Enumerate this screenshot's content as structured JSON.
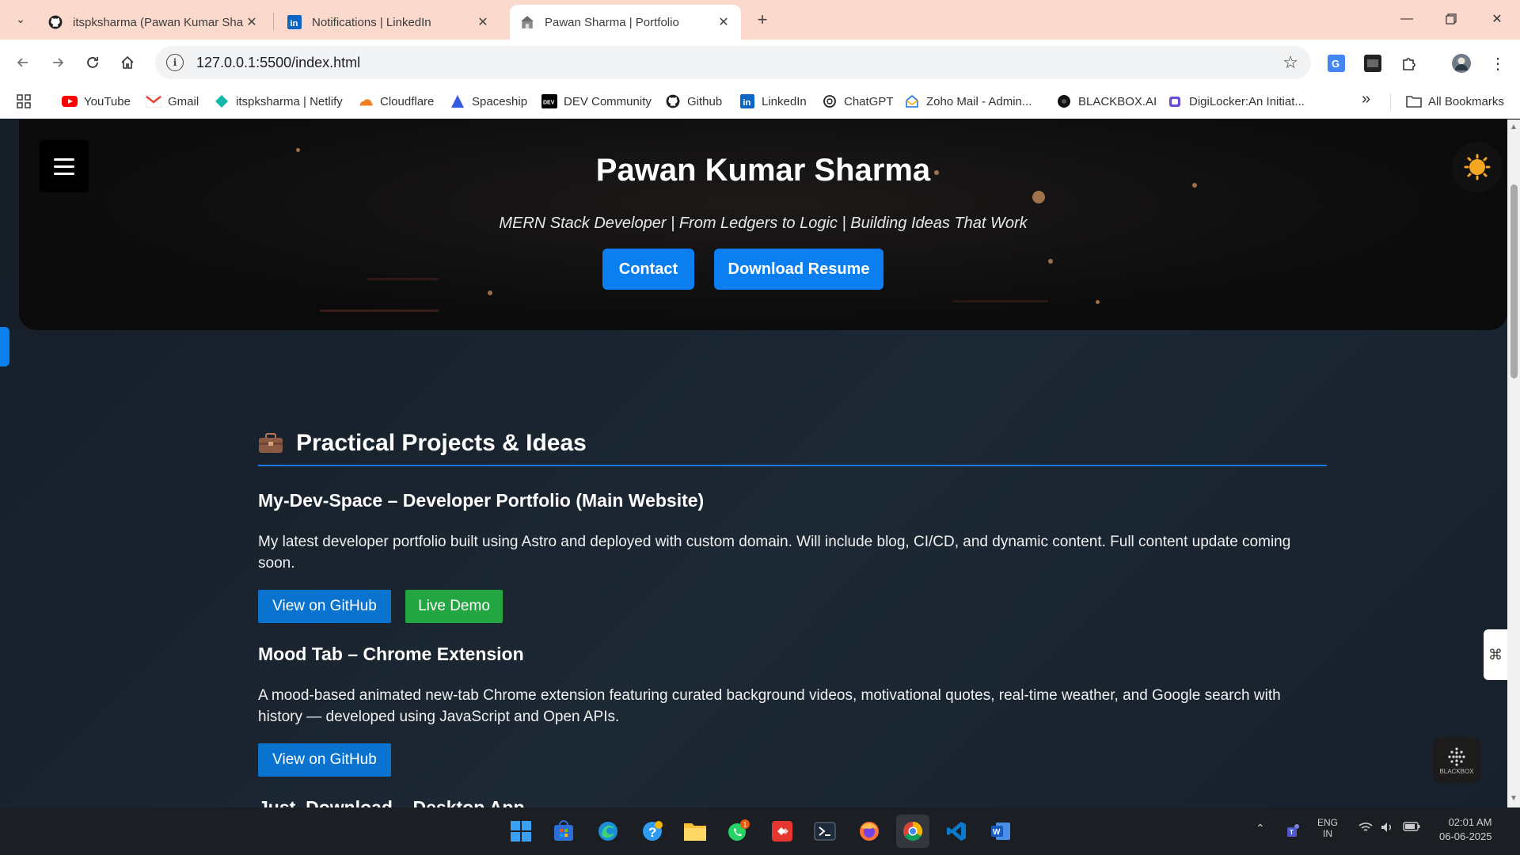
{
  "browser": {
    "tabs": [
      {
        "title": "itspksharma (Pawan Kumar Sha",
        "icon": "github-icon"
      },
      {
        "title": "Notifications | LinkedIn",
        "icon": "linkedin-icon"
      },
      {
        "title": "Pawan Sharma | Portfolio",
        "icon": "portfolio-icon",
        "active": true
      }
    ],
    "url": "127.0.0.1:5500/index.html",
    "bookmarks": [
      {
        "label": "YouTube"
      },
      {
        "label": "Gmail"
      },
      {
        "label": "itspksharma | Netlify"
      },
      {
        "label": "Cloudflare"
      },
      {
        "label": "Spaceship"
      },
      {
        "label": "DEV Community"
      },
      {
        "label": "Github"
      },
      {
        "label": "LinkedIn"
      },
      {
        "label": "ChatGPT"
      },
      {
        "label": "Zoho Mail - Admin..."
      },
      {
        "label": "BLACKBOX.AI"
      },
      {
        "label": "DigiLocker:An Initiat..."
      }
    ],
    "all_bookmarks": "All Bookmarks",
    "overflow": "»"
  },
  "hero": {
    "name": "Pawan Kumar Sharma",
    "tagline": "MERN Stack Developer | From Ledgers to Logic | Building Ideas That Work",
    "contact_label": "Contact",
    "resume_label": "Download Resume"
  },
  "projects_section": {
    "title": "Practical Projects & Ideas",
    "projects": [
      {
        "title": "My-Dev-Space – Developer Portfolio (Main Website)",
        "description": "My latest developer portfolio built using Astro and deployed with custom domain. Will include blog, CI/CD, and dynamic content. Full content update coming soon.",
        "github_label": "View on GitHub",
        "demo_label": "Live Demo"
      },
      {
        "title": "Mood Tab – Chrome Extension",
        "description": "A mood-based animated new-tab Chrome extension featuring curated background videos, motivational quotes, real-time weather, and Google search with history — developed using JavaScript and Open APIs.",
        "github_label": "View on GitHub"
      },
      {
        "title": "Just_Download – Desktop App"
      }
    ]
  },
  "widgets": {
    "blackbox_label": "BLACKBOX"
  },
  "taskbar": {
    "whatsapp_badge": "1",
    "lang": "ENG",
    "region": "IN",
    "time": "02:01 AM",
    "date": "06-06-2025"
  },
  "colors": {
    "accent": "#0b7ef0",
    "github_button": "#0a73d0",
    "demo_button": "#23a541",
    "tab_bar": "#fbd9cc"
  }
}
